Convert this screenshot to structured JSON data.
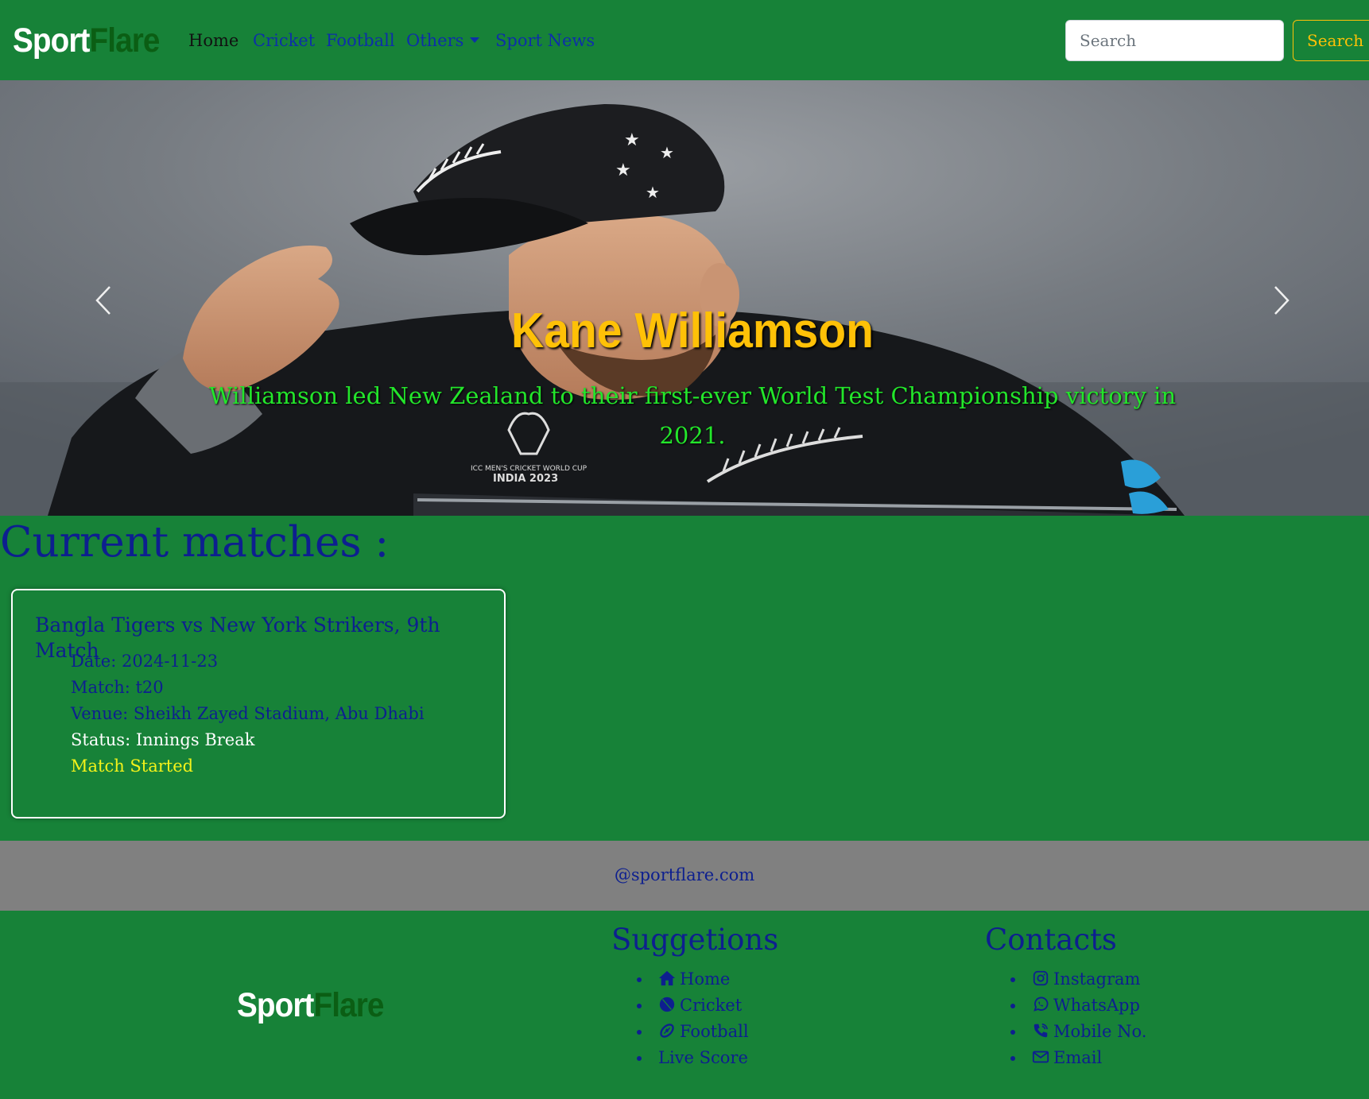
{
  "brand": {
    "part1": "Sport",
    "part2": "Flare"
  },
  "nav": {
    "items": [
      {
        "label": "Home"
      },
      {
        "label": "Cricket"
      },
      {
        "label": "Football"
      },
      {
        "label": "Others"
      },
      {
        "label": "Sport News"
      }
    ]
  },
  "search": {
    "placeholder": "Search",
    "button_label": "Search"
  },
  "carousel": {
    "title": "Kane Williamson",
    "text": "Williamson led New Zealand to their first-ever World Test Championship victory in 2021.",
    "image_badge": "ICC MEN'S CRICKET WORLD CUP INDIA 2023",
    "prev_icon": "chevron-left-icon",
    "next_icon": "chevron-right-icon"
  },
  "matches": {
    "section_title": "Current matches :",
    "items": [
      {
        "title": "Bangla Tigers vs New York Strikers, 9th Match",
        "date": "Date: 2024-11-23",
        "match": "Match: t20",
        "venue": "Venue: Sheikh Zayed Stadium, Abu Dhabi",
        "status": "Status: Innings Break",
        "state": "Match Started"
      }
    ]
  },
  "footer_strip": {
    "text": "@sportflare.com"
  },
  "footer": {
    "brand": {
      "part1": "Sport",
      "part2": "Flare"
    },
    "suggestions": {
      "title": "Suggetions",
      "items": [
        {
          "label": "Home",
          "icon": "home-icon"
        },
        {
          "label": "Cricket",
          "icon": "cricket-ball-icon"
        },
        {
          "label": "Football",
          "icon": "football-icon"
        },
        {
          "label": "Live Score",
          "icon": ""
        }
      ]
    },
    "contacts": {
      "title": "Contacts",
      "items": [
        {
          "label": "Instagram",
          "icon": "instagram-icon"
        },
        {
          "label": "WhatsApp",
          "icon": "whatsapp-icon"
        },
        {
          "label": "Mobile No.",
          "icon": "phone-icon"
        },
        {
          "label": "Email",
          "icon": "envelope-icon"
        }
      ]
    }
  },
  "colors": {
    "background": "#178238",
    "nav_link": "#0d2fa8",
    "heading": "#0d1f8f",
    "accent_yellow": "#ffc107",
    "caption_green": "#23e62b",
    "footer_strip": "#808080"
  }
}
